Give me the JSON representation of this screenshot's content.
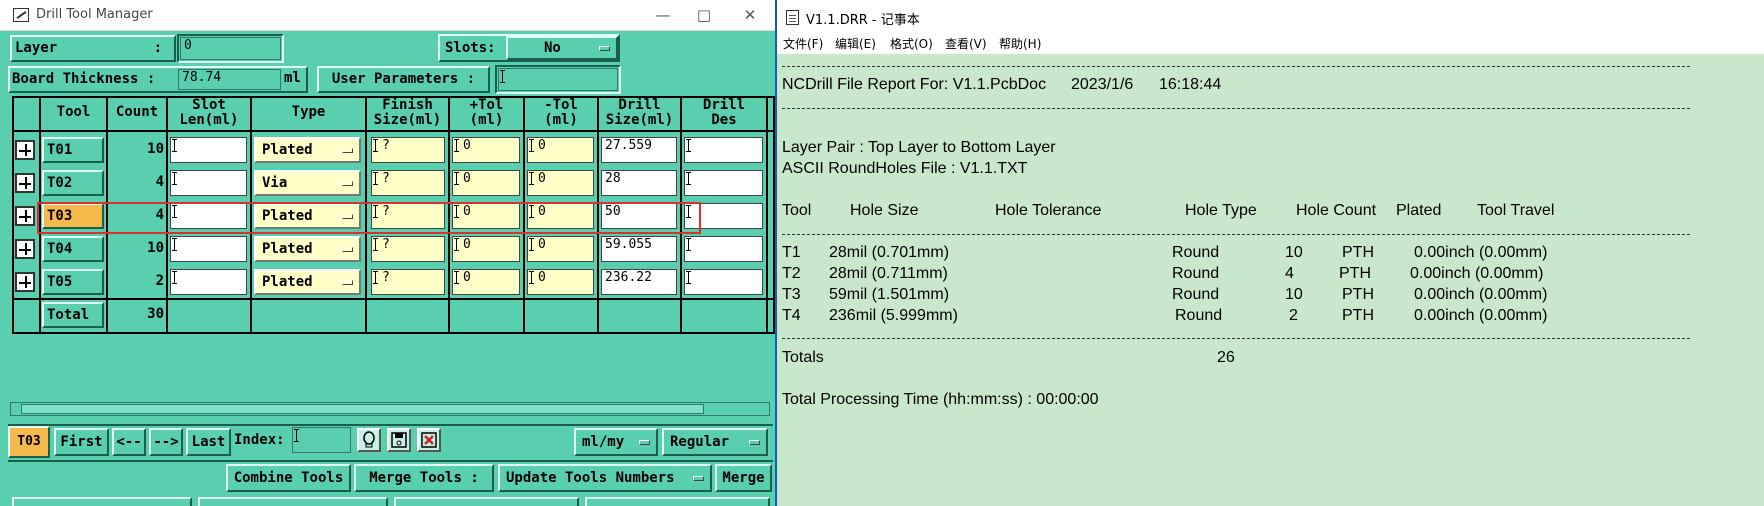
{
  "drill": {
    "title": "Drill Tool Manager",
    "layer_label": "Layer",
    "layer_colon": ":",
    "layer_value": "0",
    "slots_label": "Slots:",
    "slots_value": "No",
    "thickness_label": "Board Thickness :",
    "thickness_value": "78.74",
    "thickness_unit": "ml",
    "user_params_label": "User Parameters :",
    "headers": {
      "tool": "Tool",
      "count": "Count",
      "slot1": "Slot",
      "slot2": "Len(ml)",
      "type": "Type",
      "finish1": "Finish",
      "finish2": "Size(ml)",
      "ptol1": "+Tol",
      "ptol2": "(ml)",
      "ntol1": "-Tol",
      "ntol2": "(ml)",
      "drill1": "Drill",
      "drill2": "Size(ml)",
      "des1": "Drill",
      "des2": "Des"
    },
    "rows": [
      {
        "tool": "T01",
        "count": "10",
        "type": "Plated",
        "finish": "?",
        "ptol": "0",
        "ntol": "0",
        "drill": "27.559"
      },
      {
        "tool": "T02",
        "count": "4",
        "type": "Via",
        "finish": "?",
        "ptol": "0",
        "ntol": "0",
        "drill": "28"
      },
      {
        "tool": "T03",
        "count": "4",
        "type": "Plated",
        "finish": "?",
        "ptol": "0",
        "ntol": "0",
        "drill": "50"
      },
      {
        "tool": "T04",
        "count": "10",
        "type": "Plated",
        "finish": "?",
        "ptol": "0",
        "ntol": "0",
        "drill": "59.055"
      },
      {
        "tool": "T05",
        "count": "2",
        "type": "Plated",
        "finish": "?",
        "ptol": "0",
        "ntol": "0",
        "drill": "236.22"
      }
    ],
    "total_label": "Total",
    "total_count": "30",
    "nav": {
      "current": "T03",
      "first": "First",
      "prev": "<--",
      "next": "-->",
      "last": "Last",
      "index_label": "Index:",
      "units": "ml/my",
      "mode": "Regular"
    },
    "bottom": {
      "combine": "Combine Tools",
      "merge_label": "Merge Tools :",
      "update": "Update Tools Numbers",
      "merge": "Merge"
    }
  },
  "notepad": {
    "title": "V1.1.DRR - 记事本",
    "menu": [
      "文件(F)",
      "编辑(E)",
      "格式(O)",
      "查看(V)",
      "帮助(H)"
    ],
    "report_title": "NCDrill File Report For: V1.1.PcbDoc",
    "report_date": "2023/1/6",
    "report_time": "16:18:44",
    "layer_pair": "Layer Pair : Top Layer to Bottom Layer",
    "ascii_file": "ASCII RoundHoles File : V1.1.TXT",
    "cols": [
      "Tool",
      "Hole Size",
      "Hole Tolerance",
      "Hole Type",
      "Hole Count",
      "Plated",
      "Tool Travel"
    ],
    "rows": [
      {
        "tool": "T1",
        "size": "28mil (0.701mm)",
        "type": "Round",
        "count": "10",
        "plated": "PTH",
        "travel": "0.00inch (0.00mm)"
      },
      {
        "tool": "T2",
        "size": "28mil (0.711mm)",
        "type": "Round",
        "count": "4",
        "plated": "PTH",
        "travel": "0.00inch (0.00mm)"
      },
      {
        "tool": "T3",
        "size": "59mil (1.501mm)",
        "type": "Round",
        "count": "10",
        "plated": "PTH",
        "travel": "0.00inch (0.00mm)"
      },
      {
        "tool": "T4",
        "size": "236mil (5.999mm)",
        "type": "Round",
        "count": "2",
        "plated": "PTH",
        "travel": "0.00inch (0.00mm)"
      }
    ],
    "totals_label": "Totals",
    "totals_value": "26",
    "processing": "Total Processing Time (hh:mm:ss) : 00:00:00"
  }
}
